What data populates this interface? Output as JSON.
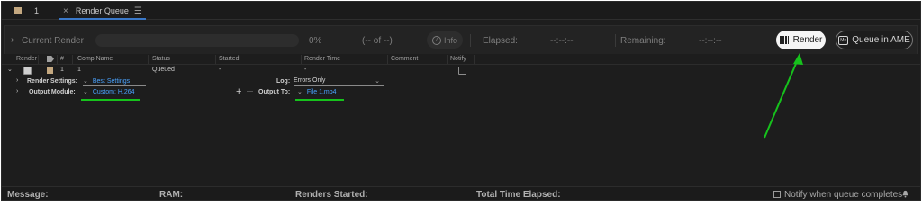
{
  "tabs": [
    {
      "label": "1"
    },
    {
      "label": "Render Queue"
    }
  ],
  "status": {
    "current_render_label": "Current Render",
    "percent": "0%",
    "of_label": "(-- of --)",
    "info_label": "Info",
    "elapsed_label": "Elapsed:",
    "elapsed_value": "--:--:--",
    "remaining_label": "Remaining:",
    "remaining_value": "--:--:--"
  },
  "buttons": {
    "render": "Render",
    "queue_ame": "Queue in AME"
  },
  "columns": [
    "Render",
    "#",
    "Comp Name",
    "Status",
    "Started",
    "Render Time",
    "Comment",
    "Notify"
  ],
  "row": {
    "number": "1",
    "comp_name": "1",
    "status": "Queued",
    "started": "-",
    "render_time": "-"
  },
  "render_settings": {
    "label": "Render Settings:",
    "value": "Best Settings",
    "log_label": "Log:",
    "log_value": "Errors Only"
  },
  "output_module": {
    "label": "Output Module:",
    "value": "Custom: H.264",
    "output_to_label": "Output To:",
    "output_to_value": "File 1.mp4",
    "add_glyph": "+",
    "remove_glyph": "—"
  },
  "footer": {
    "message": "Message:",
    "ram": "RAM:",
    "renders_started": "Renders Started:",
    "total_time_elapsed": "Total Time Elapsed:",
    "notify_label": "Notify when queue completes"
  },
  "annotation": {
    "color": "#16c21c"
  }
}
